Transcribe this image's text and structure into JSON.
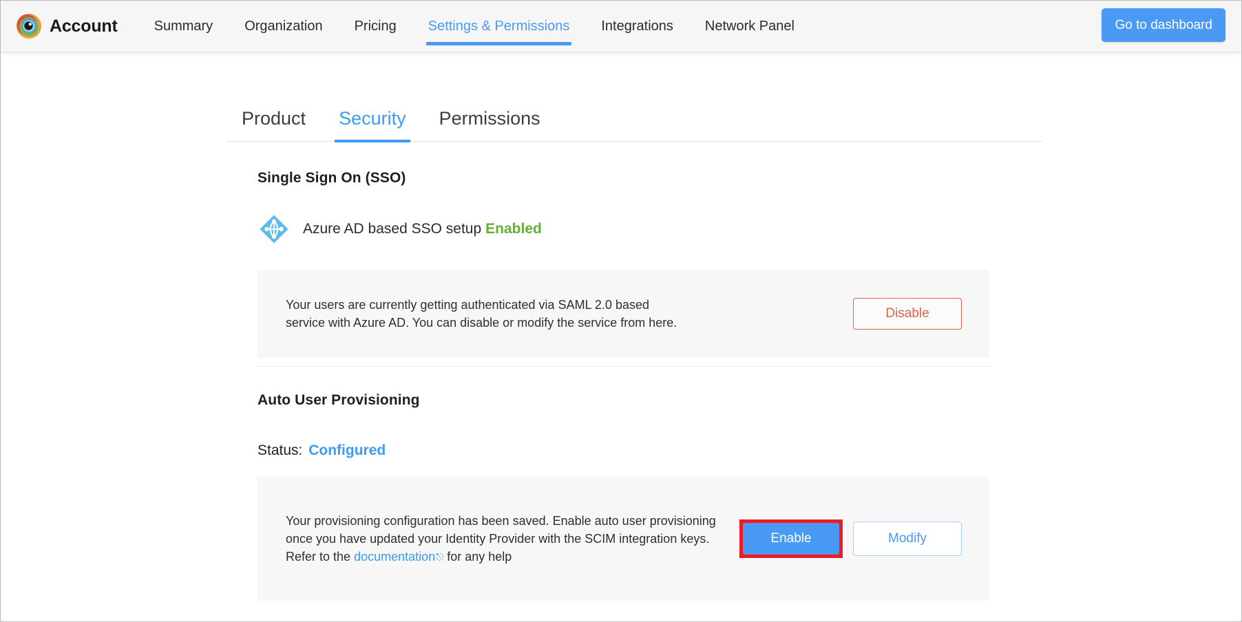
{
  "navbar": {
    "brand_name": "Account",
    "logo_icon": "eye-logo-icon",
    "items": [
      {
        "label": "Summary",
        "active": false
      },
      {
        "label": "Organization",
        "active": false
      },
      {
        "label": "Pricing",
        "active": false
      },
      {
        "label": "Settings & Permissions",
        "active": true
      },
      {
        "label": "Integrations",
        "active": false
      },
      {
        "label": "Network Panel",
        "active": false
      }
    ],
    "dashboard_button": "Go to dashboard",
    "accent_color": "#4a9af5"
  },
  "tabs": [
    {
      "label": "Product",
      "active": false
    },
    {
      "label": "Security",
      "active": true
    },
    {
      "label": "Permissions",
      "active": false
    }
  ],
  "sso": {
    "title": "Single Sign On (SSO)",
    "icon": "azure-ad-icon",
    "setup_label": "Azure AD based SSO setup",
    "status": "Enabled",
    "status_color": "#5fb234",
    "description_line1": "Your users are currently getting authenticated via SAML 2.0 based",
    "description_line2": "service with Azure AD. You can disable or modify the service from here.",
    "disable_button": "Disable",
    "disable_button_color": "#e0614a"
  },
  "provisioning": {
    "title": "Auto User Provisioning",
    "status_label": "Status:",
    "status_value": "Configured",
    "status_color": "#3d9bf2",
    "description_part1": "Your provisioning configuration has been saved. Enable auto user provisioning once you have updated your Identity Provider with the SCIM integration keys. Refer to the ",
    "description_link": "documentation",
    "link_icon": "external-link-icon",
    "description_part2": " for any help",
    "enable_button": "Enable",
    "modify_button": "Modify",
    "highlight_color": "#ed1c24",
    "enable_button_color": "#4a9af5"
  }
}
